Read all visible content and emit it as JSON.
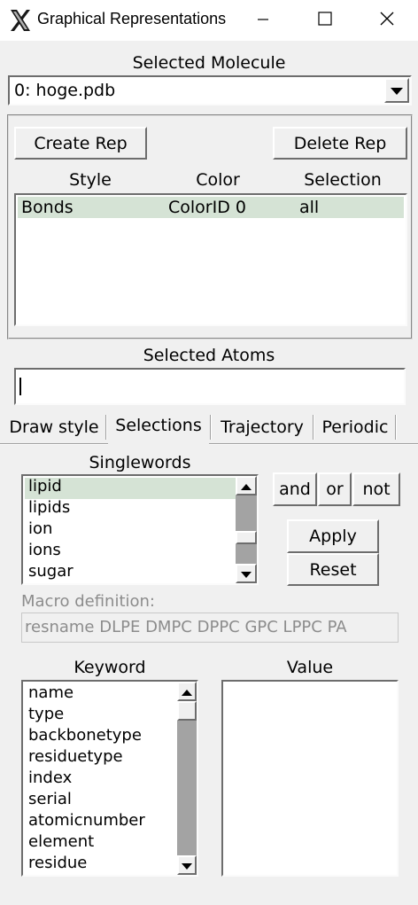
{
  "window": {
    "title": "Graphical Representations",
    "icon": "x-logo-icon",
    "controls": [
      "minimize-icon",
      "maximize-icon",
      "close-icon"
    ]
  },
  "molecule": {
    "label": "Selected Molecule",
    "value": "0: hoge.pdb"
  },
  "reps": {
    "create_label": "Create Rep",
    "delete_label": "Delete Rep",
    "headers": [
      "Style",
      "Color",
      "Selection"
    ],
    "rows": [
      {
        "style": "Bonds",
        "color": "ColorID 0",
        "selection": "all"
      }
    ]
  },
  "atoms": {
    "label": "Selected Atoms",
    "value": ""
  },
  "tabs": [
    "Draw style",
    "Selections",
    "Trajectory",
    "Periodic"
  ],
  "active_tab": "Selections",
  "selections": {
    "singlewords_label": "Singlewords",
    "singlewords": [
      "lipid",
      "lipids",
      "ion",
      "ions",
      "sugar"
    ],
    "selected_word": "lipid",
    "and_label": "and",
    "or_label": "or",
    "not_label": "not",
    "apply_label": "Apply",
    "reset_label": "Reset",
    "macro_label": "Macro definition:",
    "macro_value": "resname DLPE DMPC DPPC GPC LPPC PA",
    "keyword_label": "Keyword",
    "value_label": "Value",
    "keywords": [
      "name",
      "type",
      "backbonetype",
      "residuetype",
      "index",
      "serial",
      "atomicnumber",
      "element",
      "residue"
    ]
  },
  "colors": {
    "highlight": "#d5e3d5",
    "face": "#f0f0f0",
    "scrollbar": "#a3a3a3"
  }
}
